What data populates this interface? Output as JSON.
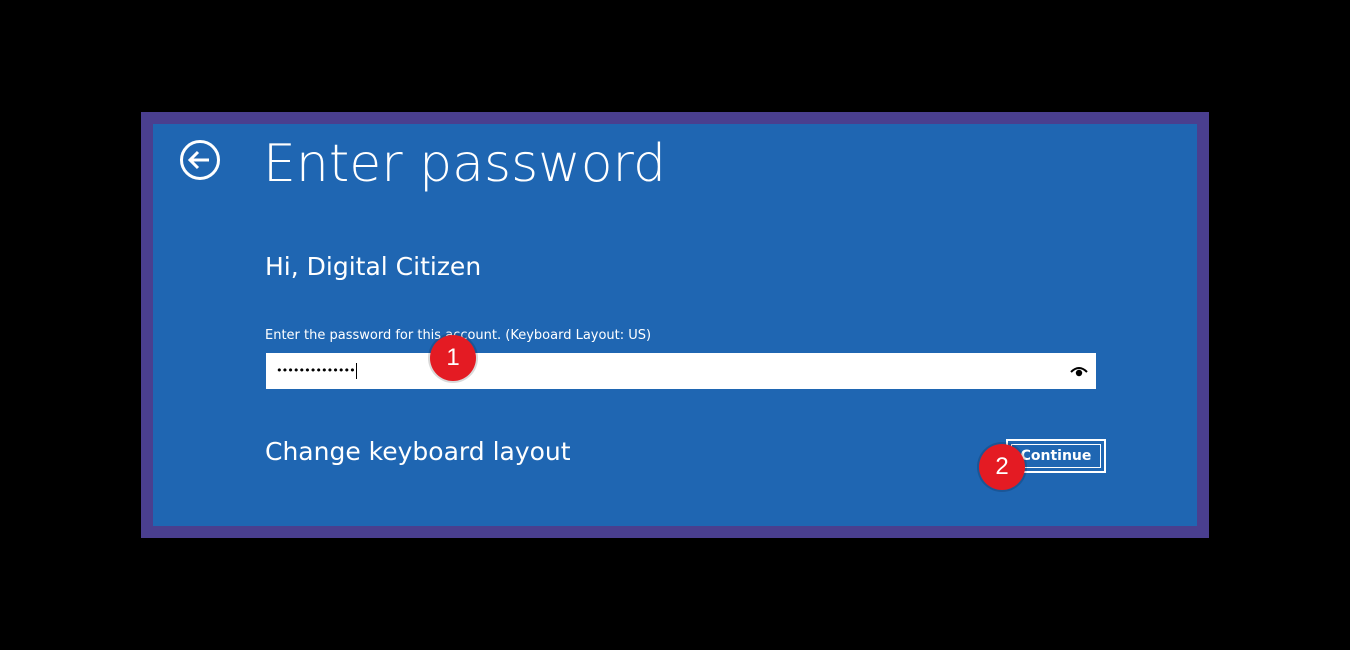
{
  "dialog": {
    "title": "Enter password",
    "greeting": "Hi, Digital Citizen",
    "prompt": "Enter the password for this account. (Keyboard Layout: US)",
    "password_value": "••••••••••••••",
    "change_keyboard_label": "Change keyboard layout",
    "continue_label": "Continue"
  },
  "icons": {
    "back": "back-arrow-icon",
    "reveal": "eye-icon"
  },
  "annotations": {
    "step1": "1",
    "step2": "2"
  },
  "colors": {
    "background": "#000000",
    "frame": "#4a3f8f",
    "panel": "#1f66b2",
    "badge": "#e41b23"
  }
}
